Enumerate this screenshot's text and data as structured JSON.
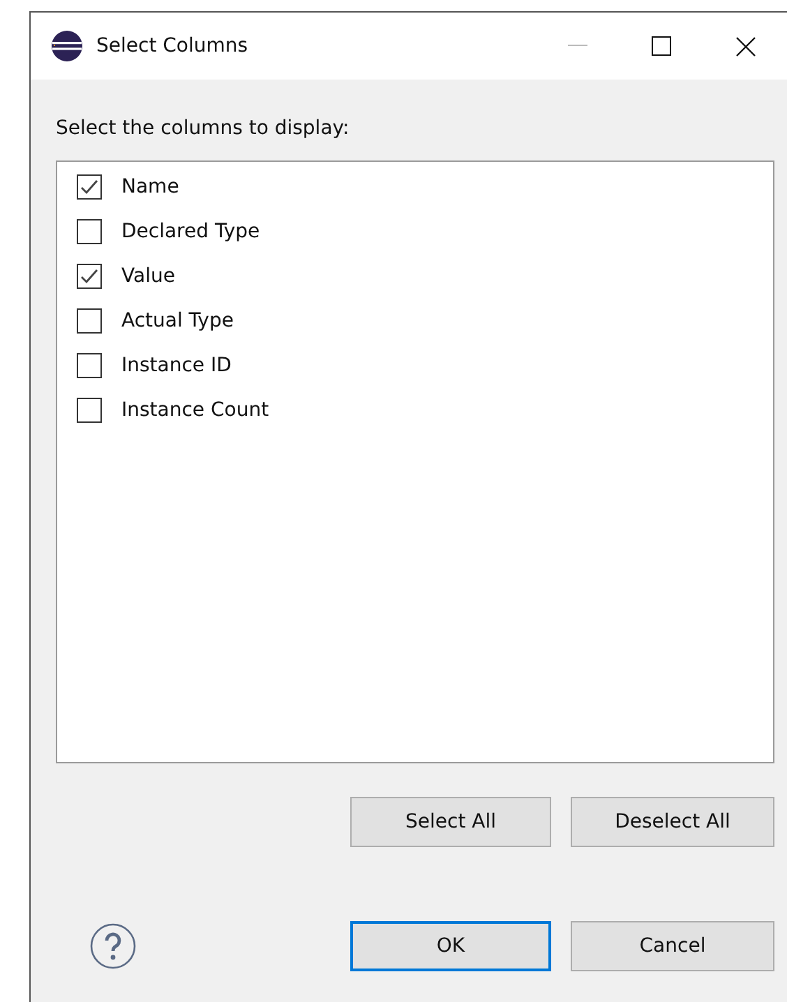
{
  "window": {
    "title": "Select Columns"
  },
  "prompt": "Select the columns to display:",
  "columns": [
    {
      "label": "Name",
      "checked": true
    },
    {
      "label": "Declared Type",
      "checked": false
    },
    {
      "label": "Value",
      "checked": true
    },
    {
      "label": "Actual Type",
      "checked": false
    },
    {
      "label": "Instance ID",
      "checked": false
    },
    {
      "label": "Instance Count",
      "checked": false
    }
  ],
  "list_buttons": [
    {
      "label": "Select All",
      "default": false
    },
    {
      "label": "Deselect All",
      "default": false
    }
  ],
  "dialog_buttons": [
    {
      "label": "OK",
      "default": true
    },
    {
      "label": "Cancel",
      "default": false
    }
  ]
}
